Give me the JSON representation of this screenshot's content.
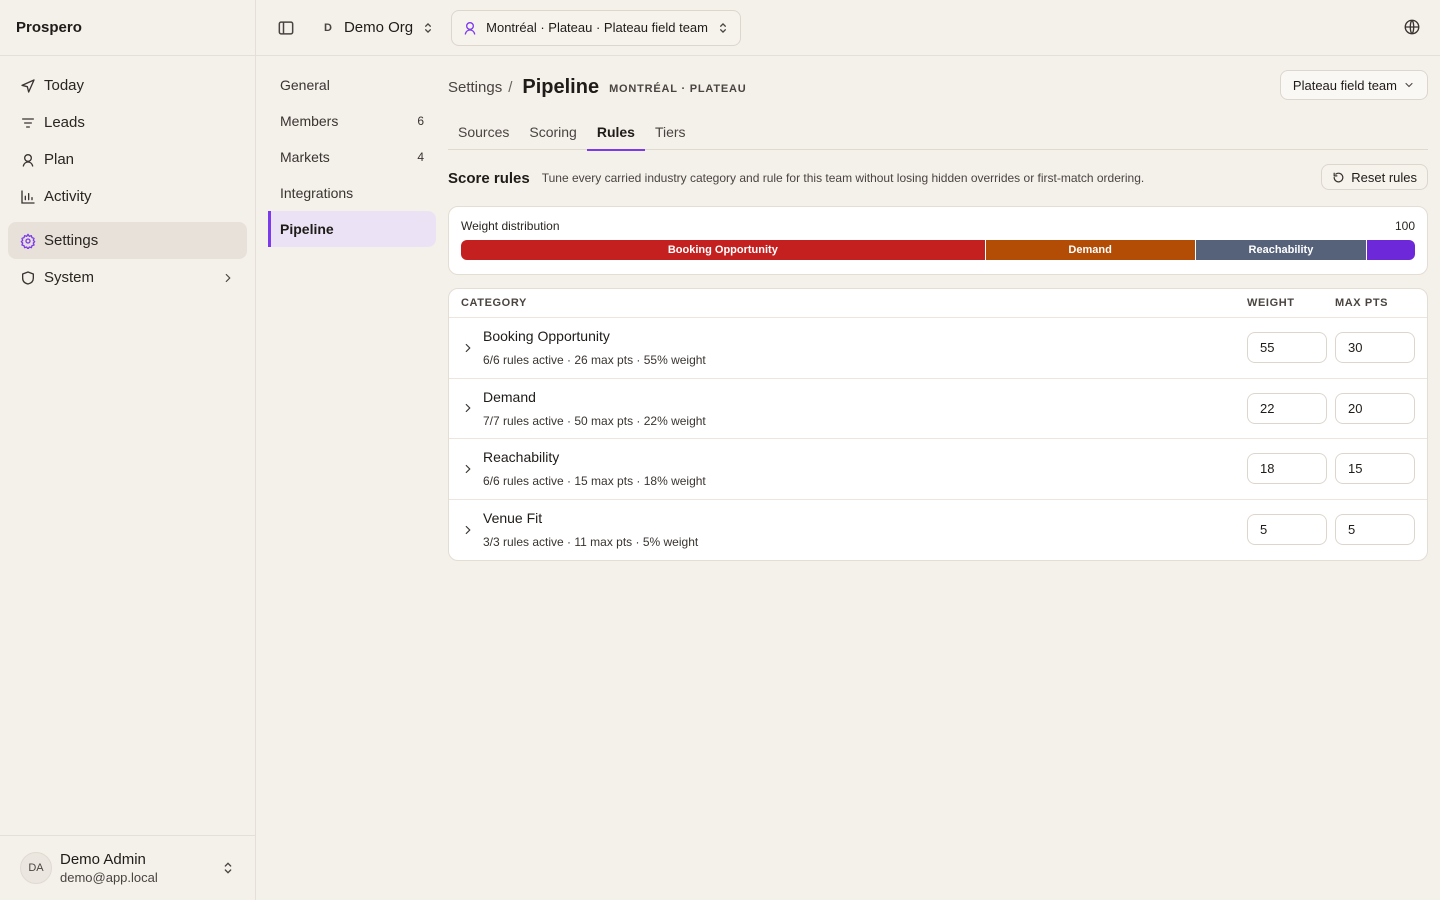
{
  "app": {
    "brand": "Prospero"
  },
  "nav": {
    "items": [
      {
        "label": "Today",
        "icon": "send-icon"
      },
      {
        "label": "Leads",
        "icon": "list-icon"
      },
      {
        "label": "Plan",
        "icon": "map-pin-icon"
      },
      {
        "label": "Activity",
        "icon": "chart-icon"
      },
      {
        "label": "Settings",
        "icon": "gear-icon",
        "active": true
      },
      {
        "label": "System",
        "icon": "shield-icon"
      }
    ]
  },
  "user": {
    "initials": "DA",
    "name": "Demo Admin",
    "email": "demo@app.local"
  },
  "topbar": {
    "org_initial": "D",
    "org_name": "Demo Org",
    "team_context": "Montréal · Plateau · Plateau field team"
  },
  "subnav": {
    "items": [
      {
        "label": "General",
        "count": ""
      },
      {
        "label": "Members",
        "count": "6"
      },
      {
        "label": "Markets",
        "count": "4"
      },
      {
        "label": "Integrations",
        "count": ""
      },
      {
        "label": "Pipeline",
        "count": "",
        "active": true
      }
    ]
  },
  "header": {
    "crumb": "Settings",
    "crumb_sep": "/",
    "title": "Pipeline",
    "subtitle": "MONTRÉAL · PLATEAU",
    "team_select": "Plateau field team"
  },
  "tabs": [
    {
      "label": "Sources"
    },
    {
      "label": "Scoring"
    },
    {
      "label": "Rules",
      "active": true
    },
    {
      "label": "Tiers"
    }
  ],
  "rules": {
    "title": "Score rules",
    "description": "Tune every carried industry category and rule for this team without losing hidden overrides or first-match ordering.",
    "reset_label": "Reset rules"
  },
  "distribution": {
    "label": "Weight distribution",
    "total": "100",
    "segments": [
      {
        "label": "Booking Opportunity",
        "weight": 55,
        "color": "#c42020"
      },
      {
        "label": "Demand",
        "weight": 22,
        "color": "#b34d06"
      },
      {
        "label": "Reachability",
        "weight": 18,
        "color": "#56627a"
      },
      {
        "label": "",
        "weight": 5,
        "color": "#6d28d9"
      }
    ]
  },
  "table": {
    "headers": {
      "category": "CATEGORY",
      "weight": "WEIGHT",
      "max_pts": "MAX PTS"
    },
    "rows": [
      {
        "name": "Booking Opportunity",
        "meta": "6/6 rules active · 26 max pts · 55% weight",
        "weight": "55",
        "max_pts": "30"
      },
      {
        "name": "Demand",
        "meta": "7/7 rules active · 50 max pts · 22% weight",
        "weight": "22",
        "max_pts": "20"
      },
      {
        "name": "Reachability",
        "meta": "6/6 rules active · 15 max pts · 18% weight",
        "weight": "18",
        "max_pts": "15"
      },
      {
        "name": "Venue Fit",
        "meta": "3/3 rules active · 11 max pts · 5% weight",
        "weight": "5",
        "max_pts": "5"
      }
    ]
  }
}
